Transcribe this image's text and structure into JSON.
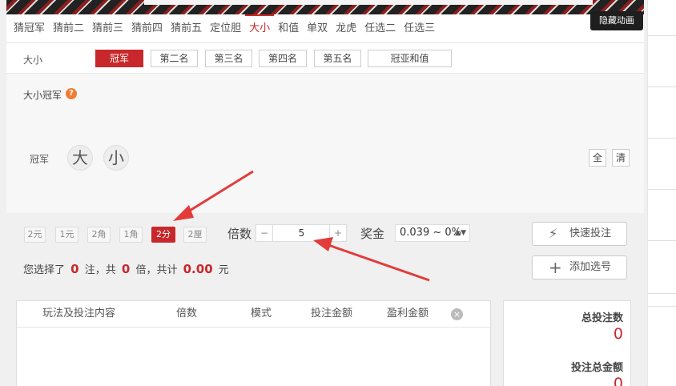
{
  "header": {
    "hide_animation": "隐藏动画"
  },
  "tabs": [
    {
      "label": "猜冠军",
      "active": false
    },
    {
      "label": "猜前二",
      "active": false
    },
    {
      "label": "猜前三",
      "active": false
    },
    {
      "label": "猜前四",
      "active": false
    },
    {
      "label": "猜前五",
      "active": false
    },
    {
      "label": "定位胆",
      "active": false
    },
    {
      "label": "大小",
      "active": true
    },
    {
      "label": "和值",
      "active": false
    },
    {
      "label": "单双",
      "active": false
    },
    {
      "label": "龙虎",
      "active": false
    },
    {
      "label": "任选二",
      "active": false
    },
    {
      "label": "任选三",
      "active": false
    }
  ],
  "subtabs": {
    "label": "大小",
    "items": [
      {
        "label": "冠军",
        "active": true
      },
      {
        "label": "第二名",
        "active": false
      },
      {
        "label": "第三名",
        "active": false
      },
      {
        "label": "第四名",
        "active": false
      },
      {
        "label": "第五名",
        "active": false
      },
      {
        "label": "冠亚和值",
        "active": false
      }
    ]
  },
  "play": {
    "title": "大小冠军",
    "help": "?",
    "row_label": "冠军",
    "balls": [
      "大",
      "小"
    ],
    "quick": {
      "all": "全",
      "clear": "清"
    }
  },
  "controls": {
    "units": [
      {
        "label": "2元",
        "active": false
      },
      {
        "label": "1元",
        "active": false
      },
      {
        "label": "2角",
        "active": false
      },
      {
        "label": "1角",
        "active": false
      },
      {
        "label": "2分",
        "active": true
      },
      {
        "label": "2厘",
        "active": false
      }
    ],
    "multiplier_label": "倍数",
    "minus": "−",
    "plus": "+",
    "multiplier_value": "5",
    "prize_label": "奖金",
    "prize_value": "0.039 ~ 0%",
    "prize_arrow": "▲▼",
    "quick_bet": "快速投注",
    "add_number": "添加选号"
  },
  "summary": {
    "prefix": "您选择了",
    "bets": "0",
    "bets_unit": "注，共",
    "times": "0",
    "times_unit": "倍，共计",
    "amount": "0.00",
    "amount_unit": "元"
  },
  "bet_table": {
    "columns": [
      "玩法及投注内容",
      "倍数",
      "模式",
      "投注金额",
      "盈利金额"
    ],
    "clear_icon": "×"
  },
  "totals": {
    "count_label": "总投注数",
    "count_value": "0",
    "amount_label": "投注总金额",
    "amount_value": "0"
  },
  "icons": {
    "bolt": "⚡",
    "plus": "+"
  },
  "colors": {
    "accent": "#c8282b",
    "arrow": "#e33b3b"
  }
}
